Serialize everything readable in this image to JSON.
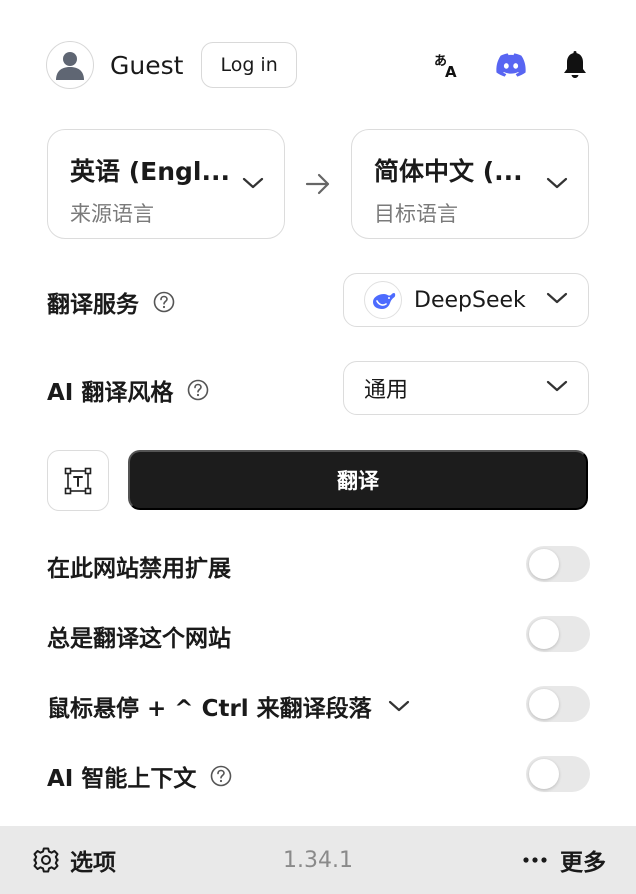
{
  "header": {
    "user_name": "Guest",
    "login_label": "Log in",
    "icons": [
      "translate-icon",
      "discord-icon",
      "bell-icon"
    ],
    "discord_color": "#5865F2"
  },
  "languages": {
    "source_name": "英语 (Engl...",
    "source_sub": "来源语言",
    "target_name": "简体中文 (...",
    "target_sub": "目标语言"
  },
  "service": {
    "label": "翻译服务",
    "selected": "DeepSeek",
    "logo_color": "#4D6BFE"
  },
  "style": {
    "label": "AI 翻译风格",
    "selected": "通用"
  },
  "actions": {
    "translate_label": "翻译"
  },
  "toggles": [
    {
      "label": "在此网站禁用扩展",
      "on": false
    },
    {
      "label": "总是翻译这个网站",
      "on": false
    },
    {
      "label": "鼠标悬停 + ^ Ctrl 来翻译段落",
      "on": false
    },
    {
      "label": "AI 智能上下文",
      "on": false
    }
  ],
  "footer": {
    "options_label": "选项",
    "version": "1.34.1",
    "more_label": "更多"
  },
  "colors": {
    "primary_button": "#1c1c1c",
    "footer_bg": "#e9e9e9",
    "toggle_off": "#e8e8e8"
  }
}
